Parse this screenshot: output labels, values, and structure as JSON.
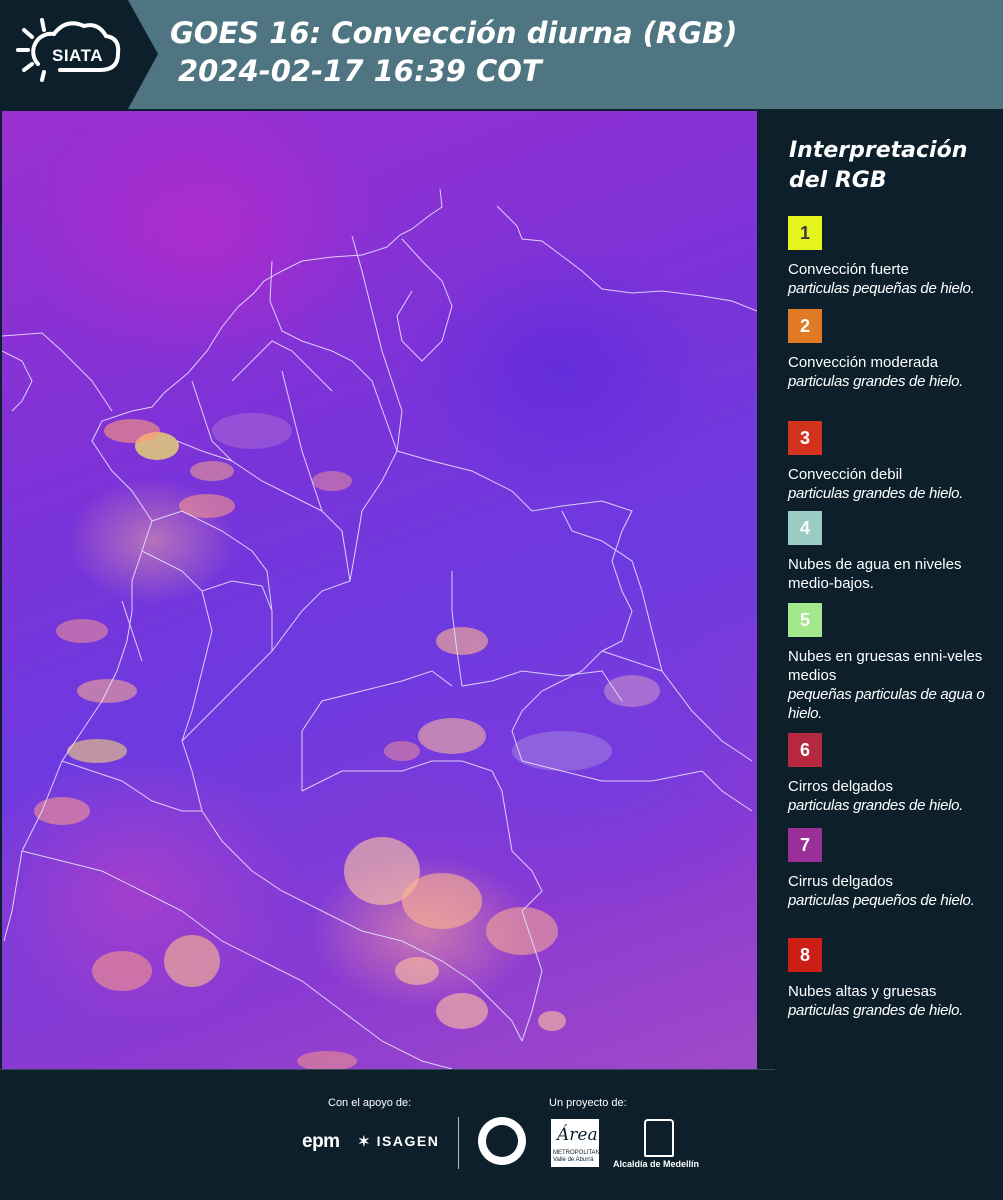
{
  "header": {
    "logo_text": "SIATA",
    "title_line1": "GOES 16: Convección diurna (RGB)",
    "title_line2": "2024-02-17 16:39 COT"
  },
  "legend": {
    "title_line1": "Interpretación",
    "title_line2": "del RGB",
    "items": [
      {
        "number": "1",
        "color": "#e7f51f",
        "number_color": "#3a3a3a",
        "name": "Convección fuerte",
        "desc": "particulas pequeñas de hielo."
      },
      {
        "number": "2",
        "color": "#e07a24",
        "number_color": "#ffffff",
        "name": "Convección moderada",
        "desc": "particulas grandes de hielo."
      },
      {
        "number": "3",
        "color": "#d2321e",
        "number_color": "#ffffff",
        "name": "Convección debil",
        "desc": "particulas grandes de hielo."
      },
      {
        "number": "4",
        "color": "#9ccbc4",
        "number_color": "#ffffff",
        "name": "Nubes de agua en niveles medio-bajos.",
        "desc": ""
      },
      {
        "number": "5",
        "color": "#a3e88c",
        "number_color": "#ffffff",
        "name": "Nubes en gruesas enni-veles medios",
        "desc": "pequeñas particulas de agua o hielo."
      },
      {
        "number": "6",
        "color": "#b5283f",
        "number_color": "#ffffff",
        "name": "Cirros delgados",
        "desc": "particulas grandes de hielo."
      },
      {
        "number": "7",
        "color": "#9a2f98",
        "number_color": "#ffffff",
        "name": "Cirrus delgados",
        "desc": "particulas pequeños de hielo."
      },
      {
        "number": "8",
        "color": "#cc1d16",
        "number_color": "#ffffff",
        "name": "Nubes altas y gruesas",
        "desc": "particulas grandes de hielo."
      }
    ]
  },
  "footer": {
    "support_label": "Con el apoyo de:",
    "project_label": "Un proyecto de:",
    "sponsor_epm": "epm",
    "sponsor_isagen": "ISAGEN",
    "partner_area": "Área",
    "partner_area_sub": "METROPOLITANA Valle de Aburrá",
    "partner_alcaldia": "Alcaldía de Medellín"
  }
}
